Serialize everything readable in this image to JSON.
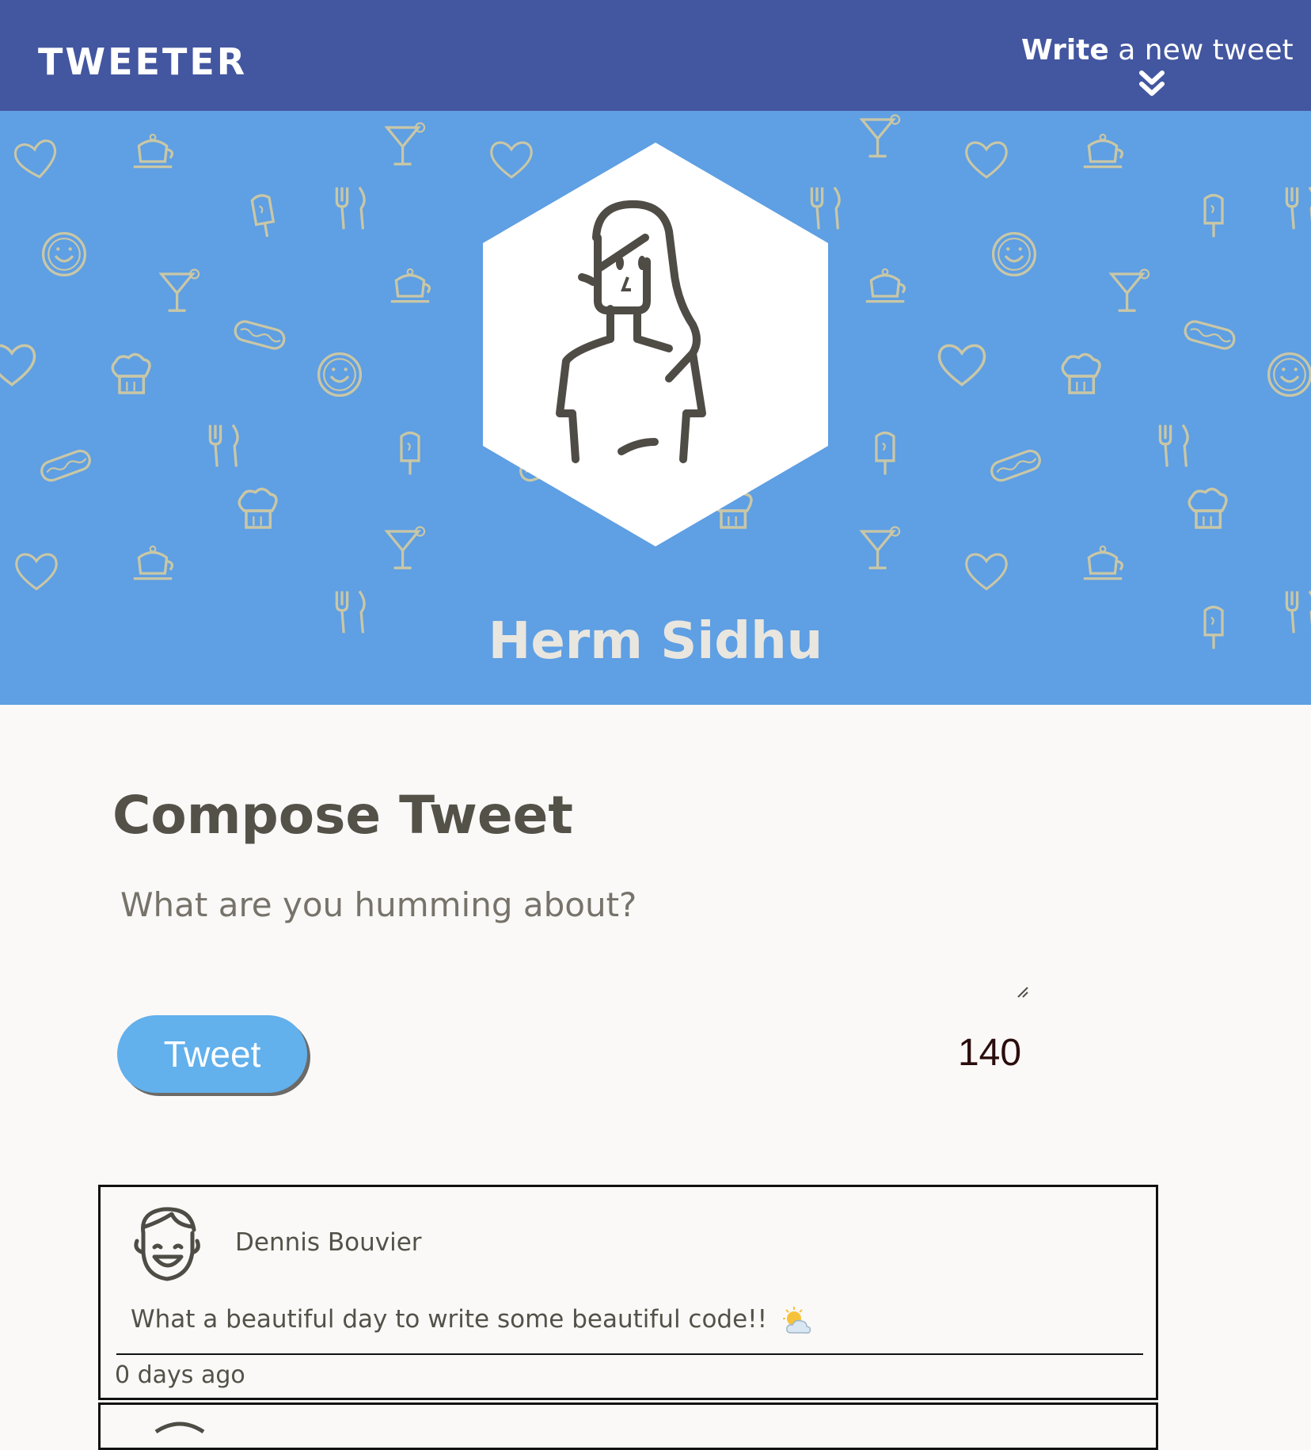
{
  "nav": {
    "brand": "TWEETER",
    "compose_toggle_bold": "Write",
    "compose_toggle_rest": "a new tweet"
  },
  "profile": {
    "name": "Herm Sidhu"
  },
  "compose": {
    "title": "Compose Tweet",
    "placeholder": "What are you humming about?",
    "submit_label": "Tweet",
    "counter": "140"
  },
  "tweets": [
    {
      "author": "Dennis Bouvier",
      "content": "What a beautiful day to write some beautiful code!!",
      "emoji_icon": "sun-behind-cloud-icon",
      "time": "0 days ago"
    }
  ],
  "colors": {
    "nav_bg": "#4356a0",
    "banner_bg": "#5f9fe3",
    "button_bg": "#62b0ec",
    "page_bg": "#faf9f7",
    "text": "#545149"
  }
}
